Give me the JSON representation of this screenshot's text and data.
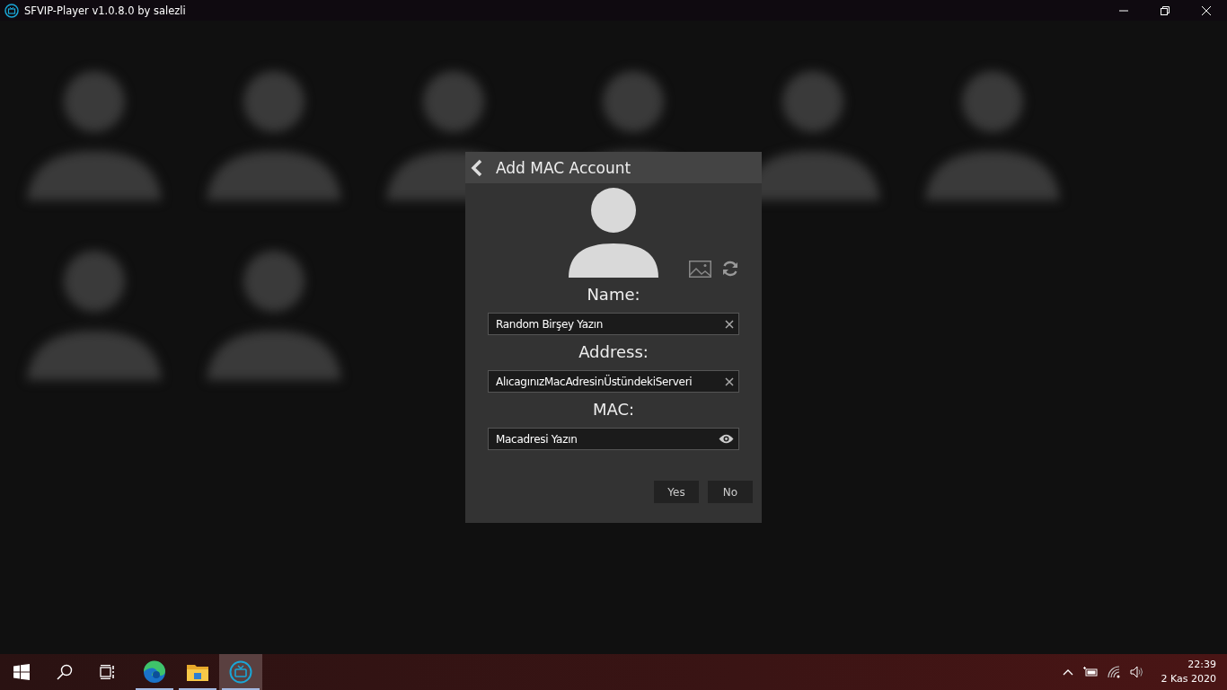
{
  "window": {
    "title": "SFVIP-Player v1.0.8.0 by salezli"
  },
  "background_tiles": [
    {
      "kind": "avatar"
    },
    {
      "kind": "avatar"
    },
    {
      "kind": "avatar"
    },
    {
      "kind": "avatar"
    },
    {
      "kind": "avatar"
    },
    {
      "kind": "avatar"
    },
    {
      "kind": "avatar"
    },
    {
      "kind": "avatar"
    }
  ],
  "dialog": {
    "title": "Add MAC Account",
    "fields": [
      {
        "label": "Name:",
        "value": "Random Birşey Yazın",
        "kind": "clear"
      },
      {
        "label": "Address:",
        "value": "AlıcagınızMacAdresinÜstündekiServeri",
        "kind": "clear"
      },
      {
        "label": "MAC:",
        "value": "Macadresi Yazın",
        "kind": "reveal"
      }
    ],
    "buttons": [
      "Yes",
      "No"
    ]
  },
  "taskbar": {
    "apps": [
      {
        "kind": "start",
        "open": false,
        "selected": false
      },
      {
        "kind": "search",
        "open": false,
        "selected": false
      },
      {
        "kind": "taskview",
        "open": false,
        "selected": false
      },
      {
        "kind": "edge",
        "open": true,
        "selected": false
      },
      {
        "kind": "explorer",
        "open": true,
        "selected": false
      },
      {
        "kind": "player",
        "open": true,
        "selected": true
      }
    ],
    "time": "22:39",
    "date": "2 Kas 2020"
  }
}
